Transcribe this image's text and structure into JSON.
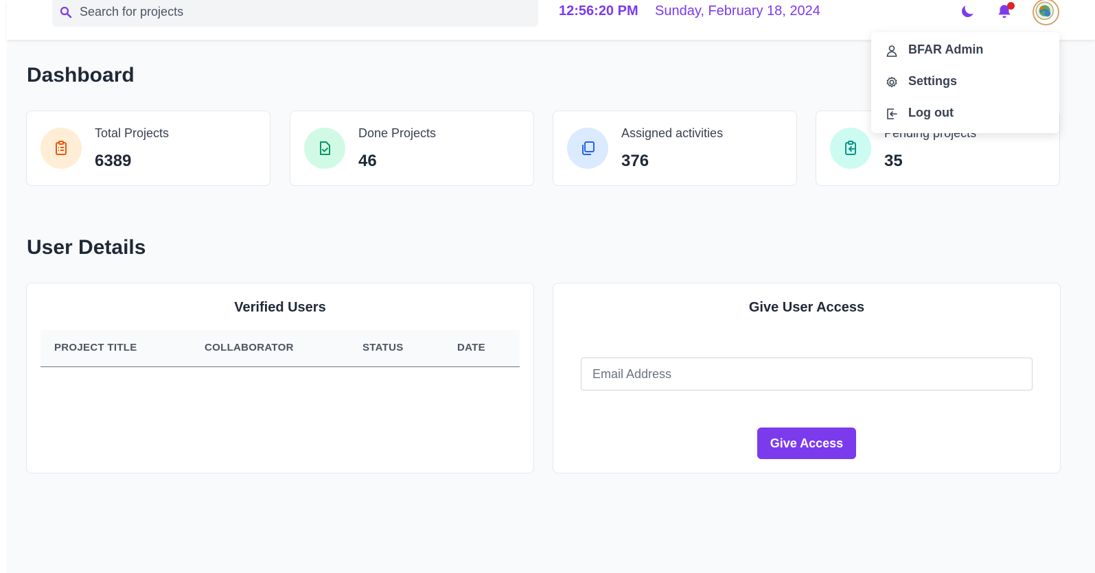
{
  "search": {
    "placeholder": "Search for projects",
    "icon": "search-icon"
  },
  "header": {
    "time": "12:56:20 PM",
    "date": "Sunday, February 18, 2024",
    "accent_color": "#7c3aed",
    "icons": [
      "moon-icon",
      "bell-icon"
    ],
    "notification_dot_color": "#dc2626"
  },
  "user_menu": {
    "items": [
      {
        "label": "BFAR Admin",
        "icon": "user-icon"
      },
      {
        "label": "Settings",
        "icon": "gear-icon"
      },
      {
        "label": "Log out",
        "icon": "logout-icon"
      }
    ]
  },
  "dashboard": {
    "title": "Dashboard",
    "cards": [
      {
        "label": "Total Projects",
        "value": "6389",
        "icon": "clipboard-list-icon",
        "color": "#ea580c",
        "bg": "#ffedd5"
      },
      {
        "label": "Done Projects",
        "value": "46",
        "icon": "document-check-icon",
        "color": "#059669",
        "bg": "#d1fae5"
      },
      {
        "label": "Assigned activities",
        "value": "376",
        "icon": "copy-icon",
        "color": "#2563eb",
        "bg": "#dbeafe"
      },
      {
        "label": "Pending projects",
        "value": "35",
        "icon": "clipboard-import-icon",
        "color": "#0d9488",
        "bg": "#ccfbf1"
      }
    ]
  },
  "user_details": {
    "title": "User Details",
    "verified_users": {
      "title": "Verified Users",
      "columns": [
        "PROJECT TITLE",
        "COLLABORATOR",
        "STATUS",
        "DATE"
      ],
      "rows": []
    },
    "give_access": {
      "title": "Give User Access",
      "email_placeholder": "Email Address",
      "button_label": "Give Access"
    }
  }
}
